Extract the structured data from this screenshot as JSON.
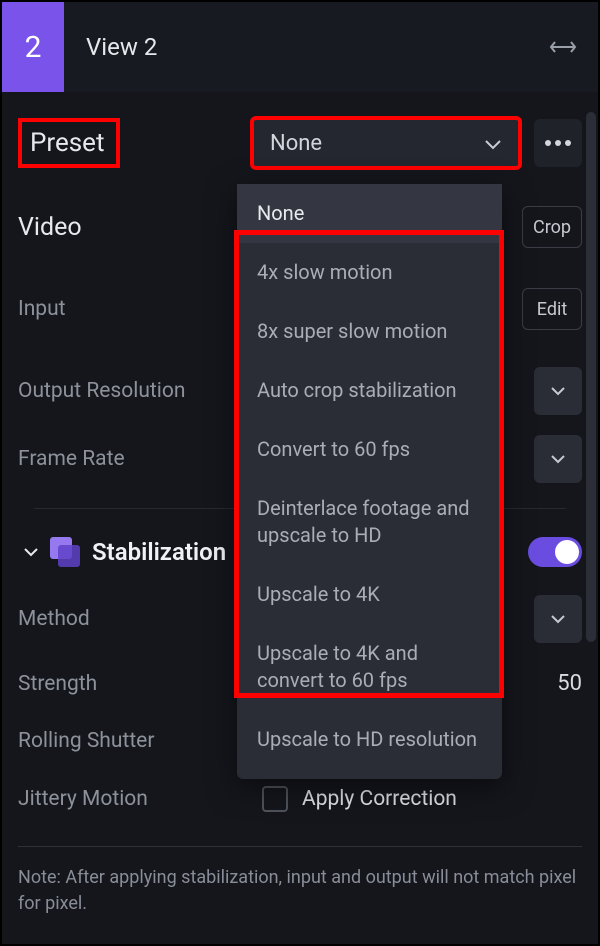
{
  "header": {
    "badge": "2",
    "title": "View 2"
  },
  "preset": {
    "label": "Preset",
    "selected": "None",
    "options": [
      "None",
      "4x slow motion",
      "8x super slow motion",
      "Auto crop stabilization",
      "Convert to 60 fps",
      "Deinterlace footage and upscale to HD",
      "Upscale to 4K",
      "Upscale to 4K and convert to 60 fps",
      "Upscale to HD resolution"
    ]
  },
  "video": {
    "heading": "Video",
    "crop_label": "Crop",
    "input_label": "Input",
    "edit_label": "Edit",
    "output_res_label": "Output Resolution",
    "frame_rate_label": "Frame Rate"
  },
  "stabilization": {
    "heading": "Stabilization",
    "method_label": "Method",
    "strength_label": "Strength",
    "strength_value": "50",
    "rolling_shutter_label": "Rolling Shutter",
    "jittery_motion_label": "Jittery Motion",
    "apply_correction_label": "Apply Correction",
    "note": "Note: After applying stabilization, input and output will not match pixel for pixel."
  }
}
